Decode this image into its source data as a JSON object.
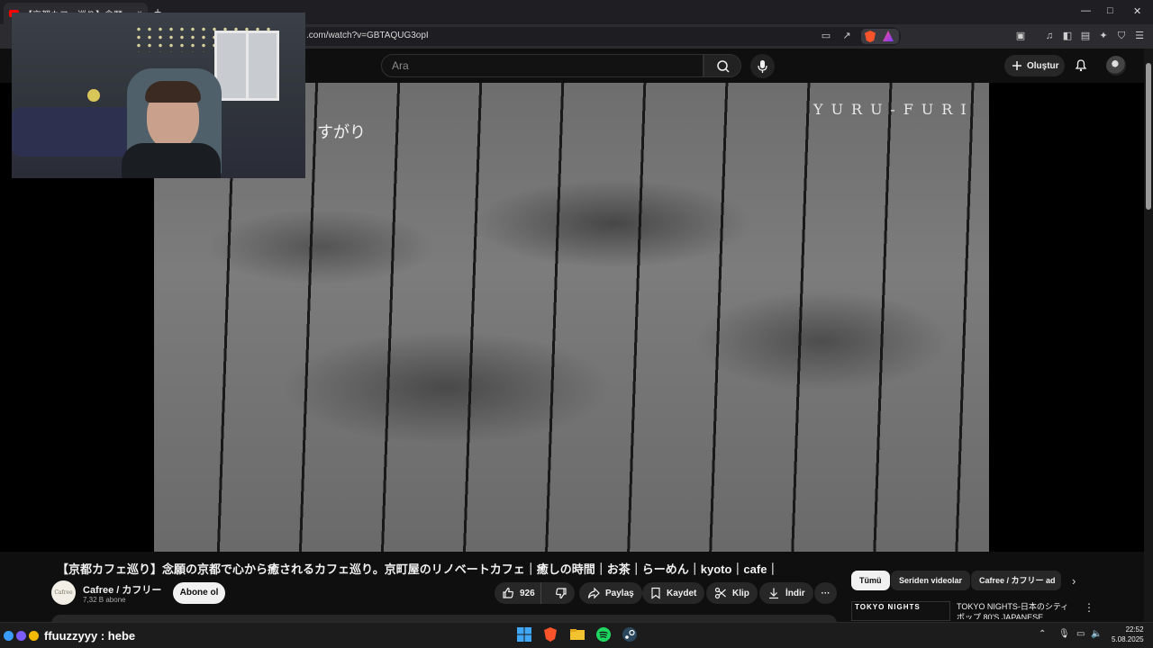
{
  "browser": {
    "tab_title": "【京都カフェ巡り】念願の京都で",
    "url": ".com/watch?v=GBTAQUG3opI",
    "new_tab": "+",
    "tab_close": "×",
    "window_controls": {
      "minimize": "—",
      "maximize": "□",
      "close": "✕"
    },
    "shield_badge": "1"
  },
  "header": {
    "search_placeholder": "Ara",
    "create_label": "Oluştur"
  },
  "video_overlay": {
    "brand_text": "YURU-FURI",
    "subtitle_text": "すがり"
  },
  "video": {
    "title": "【京都カフェ巡り】念願の京都で心から癒されるカフェ巡り。京町屋のリノベートカフェ｜癒しの時間｜お茶｜らーめん｜kyoto｜cafe｜",
    "channel_name": "Cafree / カフリー",
    "channel_avatar_text": "Cafree",
    "subscribers": "7,32 B abone",
    "subscribe_label": "Abone ol",
    "like_count": "926",
    "share_label": "Paylaş",
    "save_label": "Kaydet",
    "clip_label": "Klip",
    "download_label": "İndir",
    "more_label": "···"
  },
  "recommendations": {
    "chips": [
      "Tümü",
      "Seriden videolar",
      "Cafree / カフリー ad"
    ],
    "active_chip": 0,
    "items": [
      {
        "thumb_text": "TOKYO NIGHTS",
        "title": "TOKYO NIGHTS-日本のシティポップ 80'S JAPANESE"
      }
    ]
  },
  "taskbar": {
    "chat_message": "ffuuzzyyy : hebe",
    "time": "22:52",
    "date": "5.08.2025"
  },
  "colors": {
    "accent_red": "#ff0000",
    "background": "#0f0f0f",
    "pill": "#272727"
  }
}
